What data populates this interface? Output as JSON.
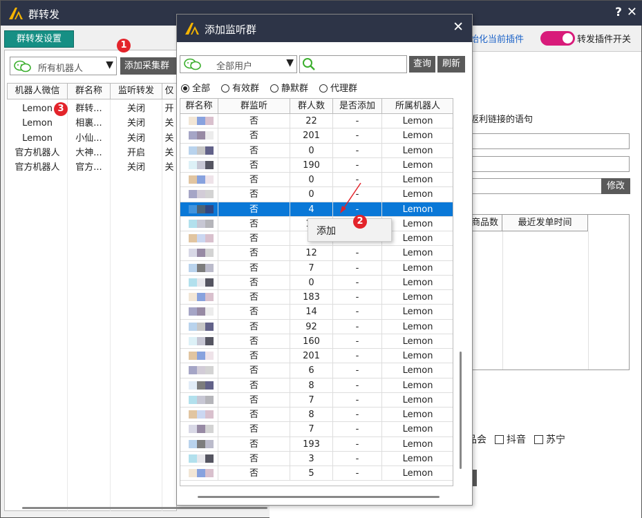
{
  "main_window": {
    "title": "群转发",
    "help": "?",
    "close": "✕"
  },
  "tab": {
    "label": "群转发设置"
  },
  "robot_select": {
    "value": "所有机器人",
    "arrow": "▼"
  },
  "add_collect_button": "添加采集群",
  "left_table": {
    "headers": [
      "机器人微信",
      "群名称",
      "监听转发",
      "仅"
    ],
    "rows": [
      [
        "Lemon",
        "群转...",
        "关闭",
        "开"
      ],
      [
        "Lemon",
        "相裏...",
        "关闭",
        "关"
      ],
      [
        "Lemon",
        "小仙...",
        "关闭",
        "关"
      ],
      [
        "官方机器人",
        "大神...",
        "开启",
        "关"
      ],
      [
        "官方机器人",
        "官方...",
        "关闭",
        "关"
      ]
    ]
  },
  "right_side": {
    "init_link": "始化当前插件",
    "toggle_label": "转发插件开关",
    "label": "返利链接的语句",
    "edit_button": "修改",
    "table_headers": [
      "商品数",
      "最近发单时间"
    ],
    "checks": {
      "lead": "品会",
      "items": [
        "抖音",
        "苏宁"
      ]
    }
  },
  "dialog": {
    "title": "添加监听群",
    "close": "✕",
    "user_select": {
      "value": "全部用户",
      "arrow": "▼"
    },
    "search": {
      "value": ""
    },
    "query_button": "查询",
    "refresh_button": "刷新",
    "filters": [
      {
        "label": "全部",
        "selected": true
      },
      {
        "label": "有效群",
        "selected": false
      },
      {
        "label": "静默群",
        "selected": false
      },
      {
        "label": "代理群",
        "selected": false
      }
    ],
    "headers": [
      "群名称",
      "群监听",
      "群人数",
      "是否添加",
      "所属机器人"
    ],
    "rows": [
      {
        "listen": "否",
        "count": "22",
        "added": "-",
        "robot": "Lemon"
      },
      {
        "listen": "否",
        "count": "201",
        "added": "-",
        "robot": "Lemon"
      },
      {
        "listen": "否",
        "count": "0",
        "added": "-",
        "robot": "Lemon"
      },
      {
        "listen": "否",
        "count": "190",
        "added": "-",
        "robot": "Lemon"
      },
      {
        "listen": "否",
        "count": "0",
        "added": "-",
        "robot": "Lemon"
      },
      {
        "listen": "否",
        "count": "0",
        "added": "-",
        "robot": "Lemon"
      },
      {
        "listen": "否",
        "count": "4",
        "added": "-",
        "robot": "Lemon",
        "selected": true
      },
      {
        "listen": "否",
        "count": "16",
        "added": "-",
        "robot": "Lemon"
      },
      {
        "listen": "否",
        "count": "0",
        "added": "-",
        "robot": "Lemon"
      },
      {
        "listen": "否",
        "count": "12",
        "added": "-",
        "robot": "Lemon"
      },
      {
        "listen": "否",
        "count": "7",
        "added": "-",
        "robot": "Lemon"
      },
      {
        "listen": "否",
        "count": "0",
        "added": "-",
        "robot": "Lemon"
      },
      {
        "listen": "否",
        "count": "183",
        "added": "-",
        "robot": "Lemon"
      },
      {
        "listen": "否",
        "count": "14",
        "added": "-",
        "robot": "Lemon"
      },
      {
        "listen": "否",
        "count": "92",
        "added": "-",
        "robot": "Lemon"
      },
      {
        "listen": "否",
        "count": "160",
        "added": "-",
        "robot": "Lemon"
      },
      {
        "listen": "否",
        "count": "201",
        "added": "-",
        "robot": "Lemon"
      },
      {
        "listen": "否",
        "count": "6",
        "added": "-",
        "robot": "Lemon"
      },
      {
        "listen": "否",
        "count": "8",
        "added": "-",
        "robot": "Lemon"
      },
      {
        "listen": "否",
        "count": "7",
        "added": "-",
        "robot": "Lemon"
      },
      {
        "listen": "否",
        "count": "8",
        "added": "-",
        "robot": "Lemon"
      },
      {
        "listen": "否",
        "count": "7",
        "added": "-",
        "robot": "Lemon"
      },
      {
        "listen": "否",
        "count": "193",
        "added": "-",
        "robot": "Lemon"
      },
      {
        "listen": "否",
        "count": "3",
        "added": "-",
        "robot": "Lemon"
      },
      {
        "listen": "否",
        "count": "5",
        "added": "-",
        "robot": "Lemon"
      }
    ]
  },
  "context_menu": {
    "item": "添加"
  },
  "badges": [
    "1",
    "2",
    "3"
  ],
  "colors": {
    "titlebar": "#2d3447",
    "tab": "#168f84",
    "selection": "#0a78d7",
    "toggle": "#d81b7a",
    "link": "#1e64c8",
    "badge": "#e3242b",
    "wechat_green": "#3aae2c"
  },
  "icons": [
    "app-logo-icon",
    "wechat-icon",
    "search-icon",
    "close-icon",
    "help-icon",
    "dropdown-arrow-icon",
    "arrow-annotation-icon"
  ]
}
